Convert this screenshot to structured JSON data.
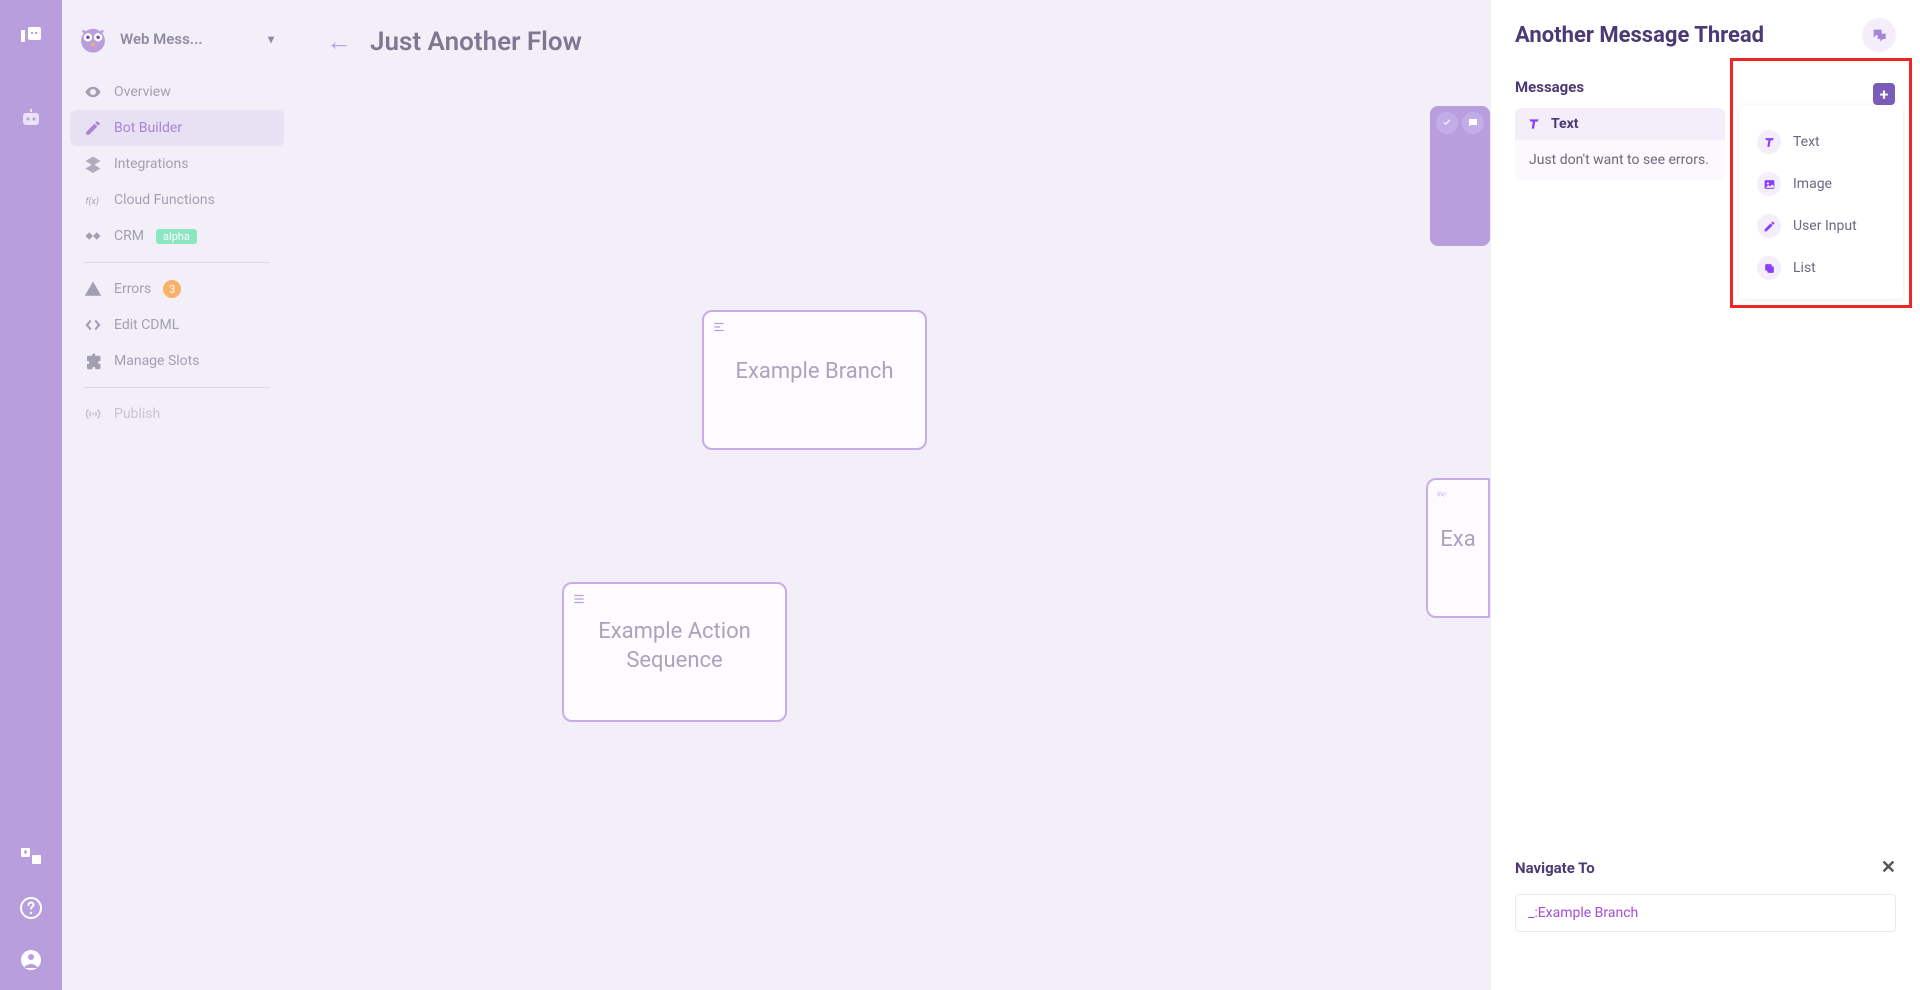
{
  "workspace": {
    "name": "Web Mess..."
  },
  "nav": {
    "overview": "Overview",
    "botBuilder": "Bot Builder",
    "integrations": "Integrations",
    "cloudFunctions": "Cloud Functions",
    "crm": "CRM",
    "crmBadge": "alpha",
    "errors": "Errors",
    "errorsCount": "3",
    "editCdml": "Edit CDML",
    "manageSlots": "Manage Slots",
    "publish": "Publish"
  },
  "flow": {
    "title": "Just Another Flow",
    "nodes": {
      "branch": "Example Branch",
      "action": "Example Action Sequence",
      "partial": "Exa"
    }
  },
  "panel": {
    "title": "Another Message Thread",
    "messagesLabel": "Messages",
    "card": {
      "type": "Text",
      "body": "Just don't want to see errors."
    },
    "navigateTo": {
      "label": "Navigate To",
      "value": "_:Example Branch"
    }
  },
  "dropdown": {
    "text": "Text",
    "image": "Image",
    "userInput": "User Input",
    "list": "List"
  }
}
